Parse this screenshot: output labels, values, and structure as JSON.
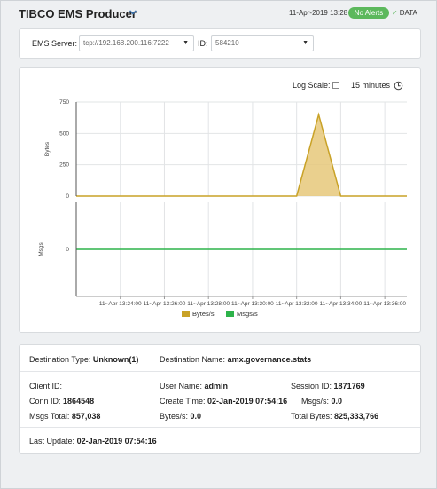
{
  "header": {
    "title": "TIBCO EMS Producer",
    "timestamp": "11-Apr-2019 13:28",
    "alert_badge": "No Alerts",
    "data_label": "DATA"
  },
  "filters": {
    "server_label": "EMS Server:",
    "server_value": "tcp://192.168.200.116:7222",
    "id_label": "ID:",
    "id_value": "584210"
  },
  "chart_controls": {
    "log_scale_label": "Log Scale:",
    "log_scale_checked": false,
    "time_range": "15 minutes"
  },
  "colors": {
    "bytes": "#c9a227",
    "bytes_fill": "#e6c87a",
    "msgs": "#2db34a",
    "alert_ok": "#5cb85c"
  },
  "chart_data": [
    {
      "type": "area",
      "ylabel": "Bytes",
      "ylim": [
        0,
        750
      ],
      "yticks": [
        0,
        250,
        500,
        750
      ],
      "x": [
        "13:22",
        "13:32",
        "13:33",
        "13:34",
        "13:37"
      ],
      "series": [
        {
          "name": "Bytes/s",
          "values": [
            0,
            0,
            650,
            0,
            0
          ]
        }
      ],
      "grid": true
    },
    {
      "type": "line",
      "ylabel": "Msgs",
      "yticks": [
        0
      ],
      "x": [
        "13:22",
        "13:37"
      ],
      "series": [
        {
          "name": "Msgs/s",
          "values": [
            0,
            0
          ]
        }
      ],
      "xtick_labels": [
        "11~Apr 13:24:00",
        "11~Apr 13:26:00",
        "11~Apr 13:28:00",
        "11~Apr 13:30:00",
        "11~Apr 13:32:00",
        "11~Apr 13:34:00",
        "11~Apr 13:36:00"
      ],
      "grid": true,
      "legend": [
        "Bytes/s",
        "Msgs/s"
      ]
    }
  ],
  "details": {
    "dest_type_label": "Destination Type:",
    "dest_type_value": "Unknown(1)",
    "dest_name_label": "Destination Name:",
    "dest_name_value": "amx.governance.stats",
    "client_id_label": "Client ID:",
    "client_id_value": "",
    "user_name_label": "User Name:",
    "user_name_value": "admin",
    "session_id_label": "Session ID:",
    "session_id_value": "1871769",
    "conn_id_label": "Conn ID:",
    "conn_id_value": "1864548",
    "create_time_label": "Create Time:",
    "create_time_value": "02-Jan-2019 07:54:16",
    "msgs_per_s_label": "Msgs/s:",
    "msgs_per_s_value": "0.0",
    "msgs_total_label": "Msgs Total:",
    "msgs_total_value": "857,038",
    "bytes_per_s_label": "Bytes/s:",
    "bytes_per_s_value": "0.0",
    "total_bytes_label": "Total Bytes:",
    "total_bytes_value": "825,333,766",
    "last_update_label": "Last Update:",
    "last_update_value": "02-Jan-2019 07:54:16"
  }
}
